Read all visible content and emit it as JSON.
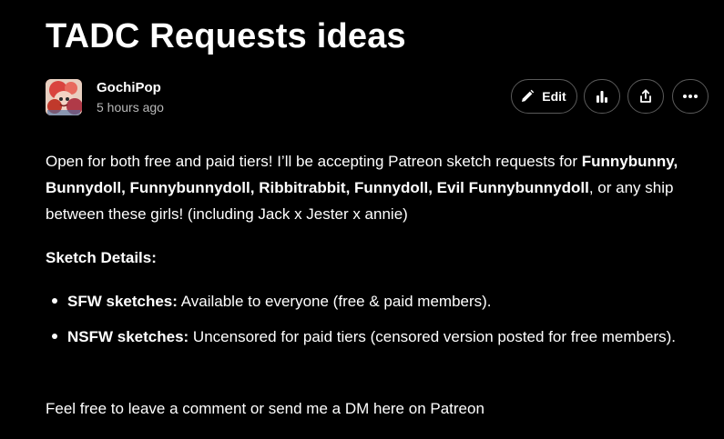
{
  "post": {
    "title": "TADC Requests ideas",
    "author": "GochiPop",
    "timestamp": "5 hours ago"
  },
  "actions": {
    "edit_label": "Edit",
    "icons": [
      "pencil-icon",
      "chart-icon",
      "share-icon",
      "more-icon"
    ]
  },
  "content": {
    "intro_start": "Open for both free and paid tiers! I’ll be accepting Patreon sketch requests for ",
    "intro_bold": "Funnybunny, Bunnydoll, Funnybunnydoll, Ribbitrabbit, Funnydoll, Evil Funnybunnydoll",
    "intro_end": ", or any ship between these girls! (including Jack x Jester x annie)",
    "details_heading": "Sketch Details:",
    "bullets": [
      {
        "label": "SFW sketches:",
        "text": " Available to everyone (free & paid members)."
      },
      {
        "label": "NSFW sketches:",
        "text": " Uncensored for paid tiers (censored version posted for free members)."
      }
    ],
    "closing": "Feel free to leave a comment or send me a DM here on Patreon"
  },
  "colors": {
    "background": "#000000",
    "text": "#ffffff",
    "muted": "#b8b8b8",
    "button_border": "#5a5a5a"
  }
}
